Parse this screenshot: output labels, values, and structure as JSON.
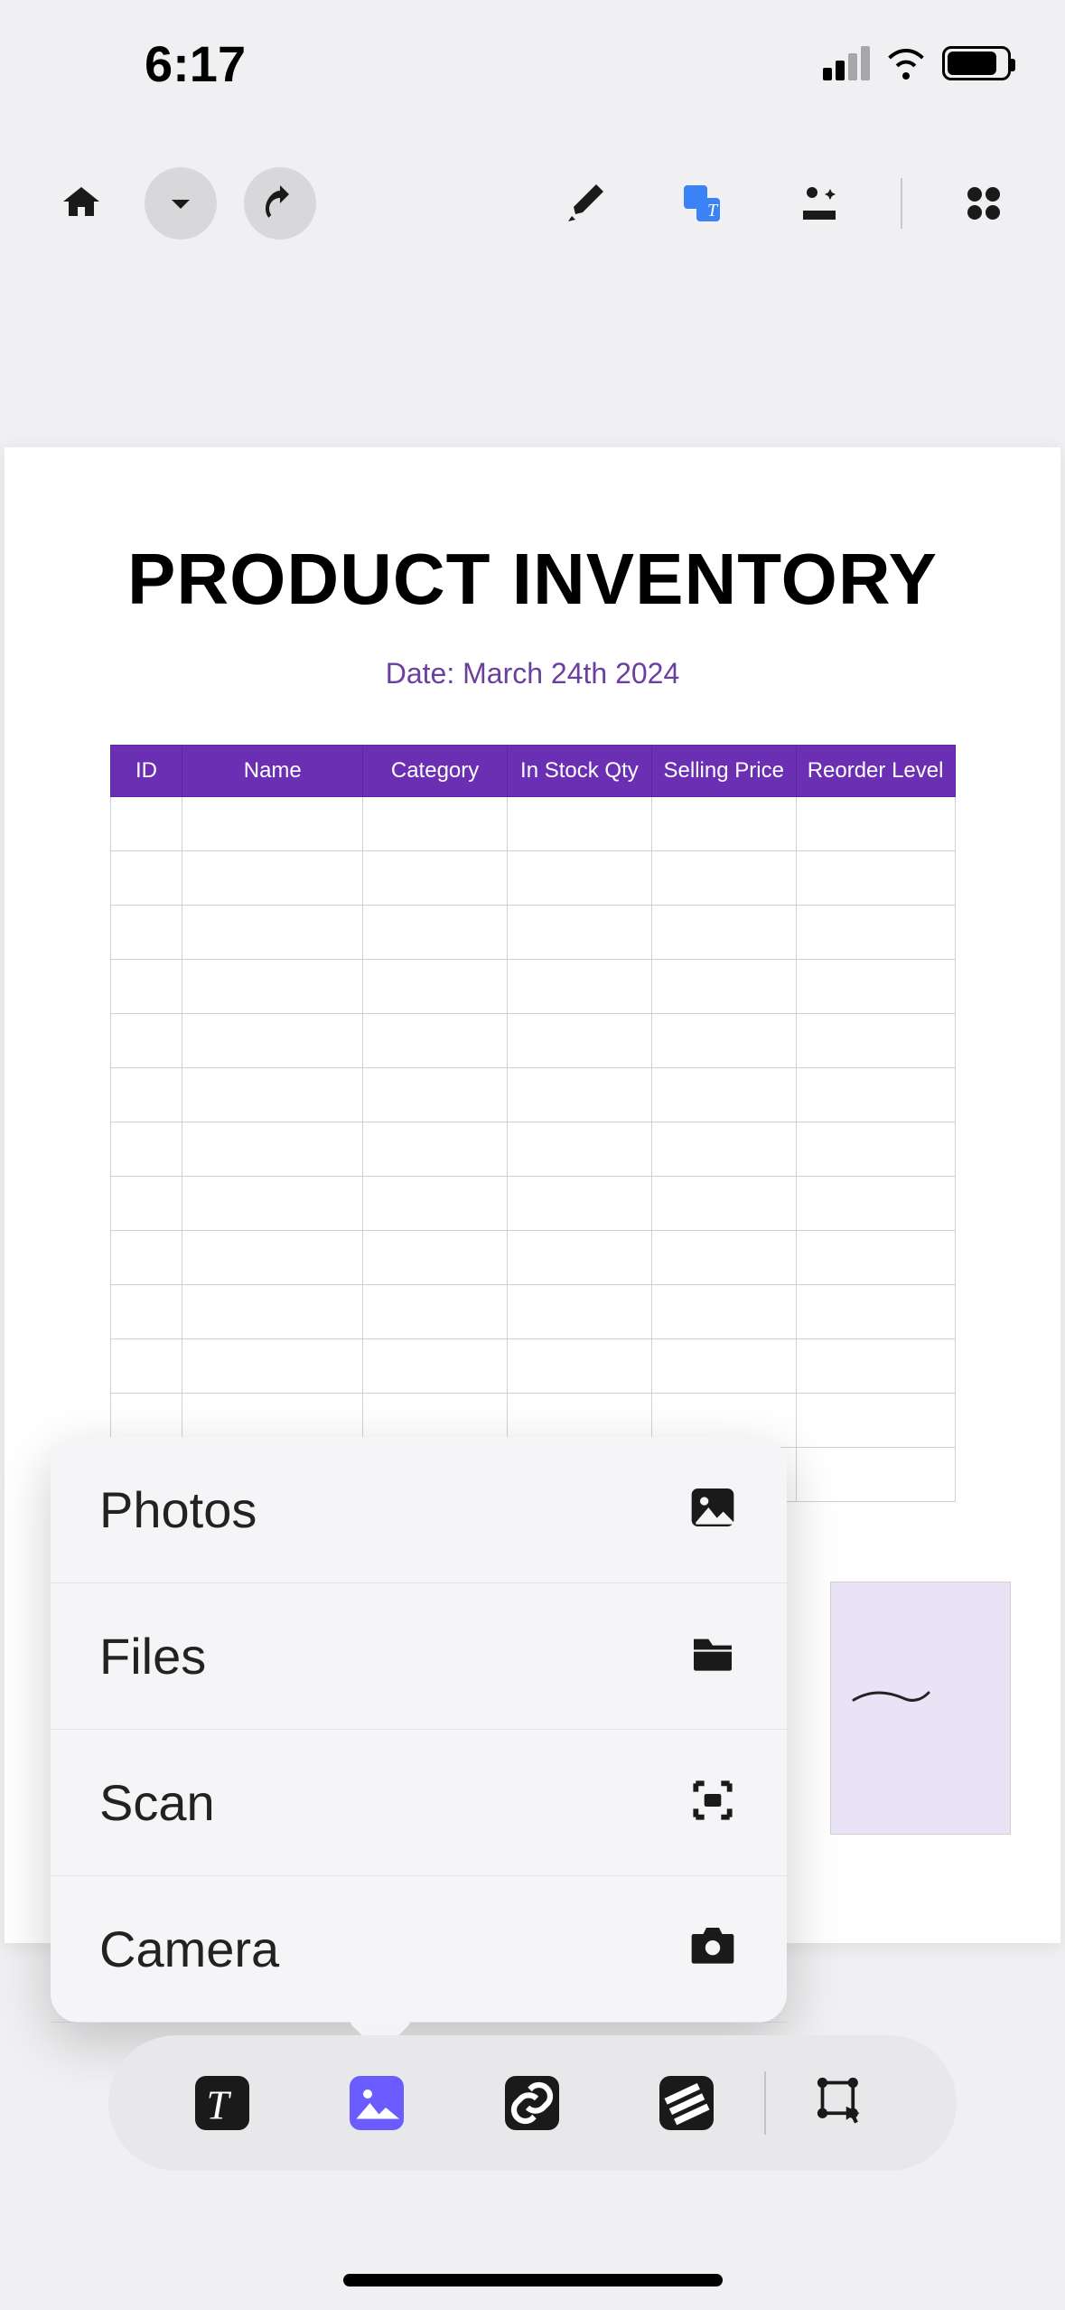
{
  "status": {
    "time": "6:17"
  },
  "document": {
    "title": "PRODUCT INVENTORY",
    "date_label": "Date: March 24th 2024",
    "columns": [
      "ID",
      "Name",
      "Category",
      "In Stock Qty",
      "Selling Price",
      "Reorder Level"
    ],
    "rows": 13
  },
  "popup": {
    "items": [
      {
        "label": "Photos",
        "icon": "image-icon"
      },
      {
        "label": "Files",
        "icon": "folder-icon"
      },
      {
        "label": "Scan",
        "icon": "scan-icon"
      },
      {
        "label": "Camera",
        "icon": "camera-icon"
      }
    ]
  },
  "top_toolbar": {
    "home": "home-icon",
    "dropdown": "chevron-down-icon",
    "undo": "undo-icon",
    "highlight": "highlighter-icon",
    "translate": "translate-icon",
    "magic": "magic-wand-icon",
    "apps": "apps-grid-icon"
  },
  "bottom_toolbar": {
    "tools": [
      "text-style",
      "image-insert",
      "link-insert",
      "style-fill",
      "select-tool"
    ],
    "active": "image-insert"
  }
}
